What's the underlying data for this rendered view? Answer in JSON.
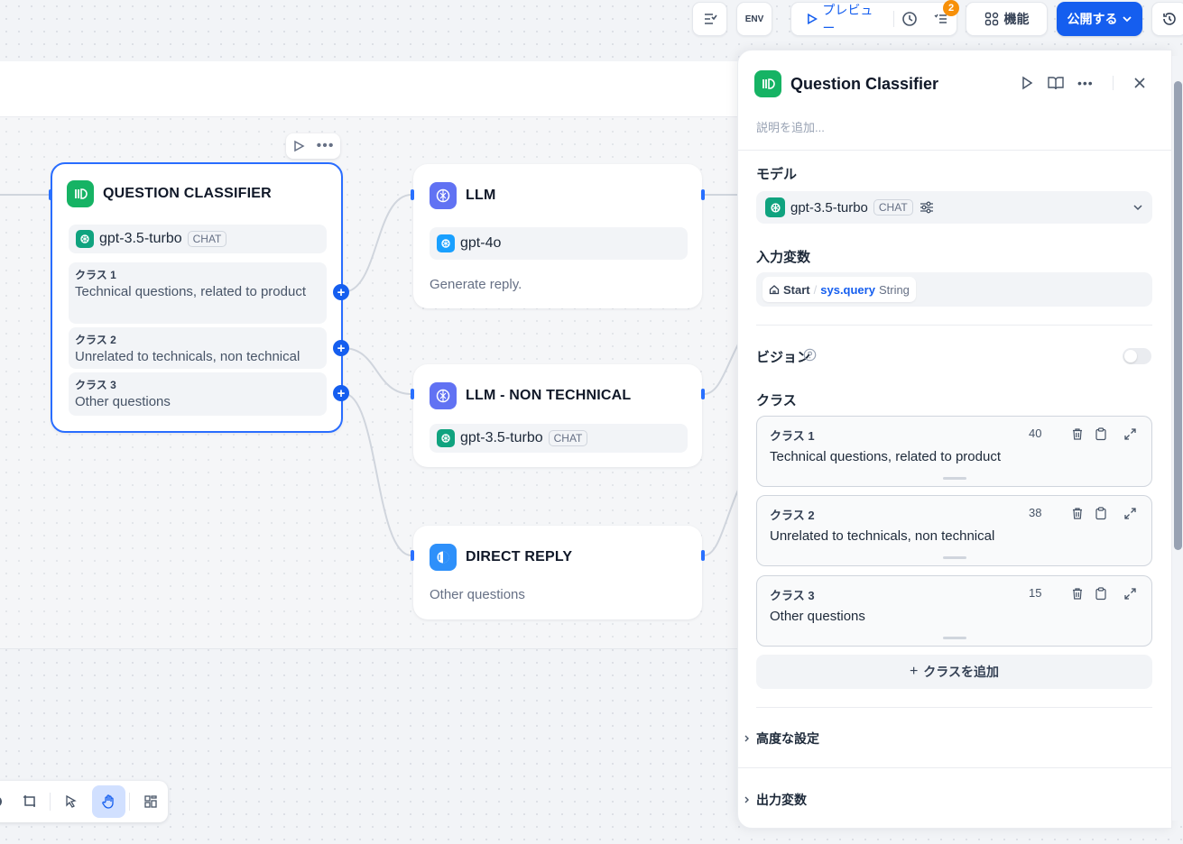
{
  "toolbar": {
    "env_label": "ENV",
    "preview_label": "プレビュー",
    "badge_count": "2",
    "features_label": "機能",
    "publish_label": "公開する"
  },
  "nodes": {
    "classifier": {
      "title": "QUESTION CLASSIFIER",
      "model": "gpt-3.5-turbo",
      "model_tag": "CHAT",
      "classes": [
        {
          "label": "クラス 1",
          "text": "Technical questions, related to product"
        },
        {
          "label": "クラス 2",
          "text": "Unrelated to technicals, non technical"
        },
        {
          "label": "クラス 3",
          "text": "Other questions"
        }
      ]
    },
    "llm": {
      "title": "LLM",
      "model": "gpt-4o",
      "desc": "Generate reply."
    },
    "llm_nt": {
      "title": "LLM - NON TECHNICAL",
      "model": "gpt-3.5-turbo",
      "model_tag": "CHAT"
    },
    "reply": {
      "title": "DIRECT REPLY",
      "desc": "Other questions"
    }
  },
  "panel": {
    "title": "Question Classifier",
    "desc_placeholder": "説明を追加...",
    "model_label": "モデル",
    "model": "gpt-3.5-turbo",
    "model_tag": "CHAT",
    "input_label": "入力変数",
    "input_var": {
      "node": "Start",
      "sep": "/",
      "var": "sys.query",
      "type": "String"
    },
    "vision_label": "ビジョン",
    "class_label": "クラス",
    "classes": [
      {
        "label": "クラス 1",
        "count": "40",
        "text": "Technical questions, related to product"
      },
      {
        "label": "クラス 2",
        "count": "38",
        "text": "Unrelated to technicals, non technical"
      },
      {
        "label": "クラス 3",
        "count": "15",
        "text": "Other questions"
      }
    ],
    "add_class_label": "クラスを追加",
    "advanced_label": "高度な設定",
    "output_label": "出力変数"
  },
  "colors": {
    "accent": "#155eef",
    "classifier_icon": "#16b364",
    "llm_icon": "#6172f3",
    "reply_icon": "#2e90fa",
    "badge": "#f79009"
  },
  "icons": {
    "classifier": "question-classifier-icon",
    "llm": "brain-icon",
    "reply": "reply-icon",
    "openai": "openai-icon"
  }
}
